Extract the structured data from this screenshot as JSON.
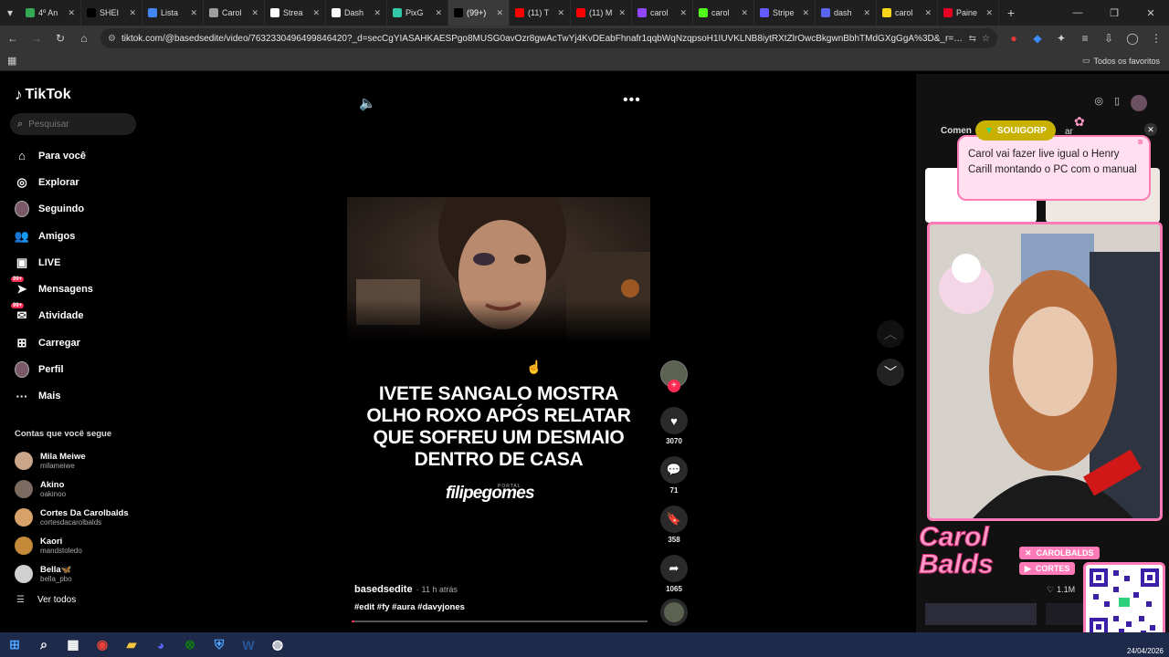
{
  "browser": {
    "tabs": [
      {
        "label": "4º An",
        "color": "#34a853"
      },
      {
        "label": "SHEI",
        "color": "#000000"
      },
      {
        "label": "Lista",
        "color": "#4285f4"
      },
      {
        "label": "Carol",
        "color": "#9e9e9e"
      },
      {
        "label": "Strea",
        "color": "#ffffff"
      },
      {
        "label": "Dash",
        "color": "#ffffff"
      },
      {
        "label": "PixG",
        "color": "#34c7a5"
      },
      {
        "label": "(99+)",
        "color": "#000000",
        "active": true
      },
      {
        "label": "(11) T",
        "color": "#ff0000"
      },
      {
        "label": "(11) M",
        "color": "#ff0000"
      },
      {
        "label": "carol",
        "color": "#9146ff"
      },
      {
        "label": "carol",
        "color": "#53fc18"
      },
      {
        "label": "Stripe",
        "color": "#635bff"
      },
      {
        "label": "dash",
        "color": "#5865f2"
      },
      {
        "label": "carol",
        "color": "#f9d71c"
      },
      {
        "label": "Paine",
        "color": "#e60023"
      }
    ],
    "new_tab": "+",
    "url": "tiktok.com/@basedsedite/video/7632330496499846420?_d=secCgYIASAHKAESPgo8MUSG0avOzr8gwAcTwYj4KvDEabFhnafr1qqbWqNzqpsoH1IUVKLNB8iytRXtZlrOwcBkgwnBbhTMdGXgGgA%3D&_r=1&_svg=1&checksum=38...",
    "bookmarks_label": "Todos os favoritos"
  },
  "tiktok": {
    "logo": "TikTok",
    "search_placeholder": "Pesquisar",
    "nav": [
      {
        "label": "Para você",
        "icon": "home-icon",
        "glyph": "⌂"
      },
      {
        "label": "Explorar",
        "icon": "compass-icon",
        "glyph": "◎"
      },
      {
        "label": "Seguindo",
        "icon": "following-avatar-icon",
        "glyph": "●"
      },
      {
        "label": "Amigos",
        "icon": "friends-icon",
        "glyph": "👥"
      },
      {
        "label": "LIVE",
        "icon": "live-icon",
        "glyph": "▣"
      },
      {
        "label": "Mensagens",
        "icon": "messages-icon",
        "glyph": "➤",
        "badge": "99+"
      },
      {
        "label": "Atividade",
        "icon": "activity-icon",
        "glyph": "✉",
        "badge": "99+"
      },
      {
        "label": "Carregar",
        "icon": "upload-icon",
        "glyph": "⊞"
      },
      {
        "label": "Perfil",
        "icon": "profile-avatar-icon",
        "glyph": "●"
      },
      {
        "label": "Mais",
        "icon": "more-icon",
        "glyph": "···"
      }
    ],
    "following_title": "Contas que você segue",
    "following": [
      {
        "name": "Mila Meiwe",
        "handle": "milameiwe",
        "color": "#c9a58a"
      },
      {
        "name": "Akino",
        "handle": "oakinoo",
        "color": "#7a6a60"
      },
      {
        "name": "Cortes Da Carolbalds",
        "handle": "cortesdacarolbalds",
        "color": "#d8a36a"
      },
      {
        "name": "Kaori",
        "handle": "mandstoledo",
        "color": "#c48a3a"
      },
      {
        "name": "Bella🦋",
        "handle": "bella_pbo",
        "color": "#d0d0d0"
      }
    ],
    "see_all": "Ver todos",
    "video": {
      "headline": "IVETE SANGALO MOSTRA OLHO ROXO APÓS RELATAR QUE SOFREU UM DESMAIO DENTRO DE CASA",
      "brand_small": "PORTAL",
      "brand": "filipegomes",
      "author": "basedsedite",
      "time_ago": "· 11 h atrás",
      "tags": "#edit #fy #aura #davyjones",
      "progress": 0.01
    },
    "actions": {
      "likes": "3070",
      "comments": "71",
      "saves": "358",
      "shares": "1065"
    }
  },
  "overlay": {
    "comments_tab": "Comen",
    "next_tab": "ar",
    "chat_user": "SOUIGORP",
    "chat_message": "Carol vai fazer live igual o Henry Carill montando o PC com o manual",
    "stream_name": "Carol Balds",
    "social_1": "CAROLBALDS",
    "social_2": "CORTES",
    "count": "1.1M"
  },
  "taskbar": {
    "date": "24/04/2026",
    "apps": [
      {
        "icon": "windows-start-icon",
        "glyph": "⊞",
        "color": "#4aa3ff"
      },
      {
        "icon": "search-icon",
        "glyph": "⌕",
        "color": "#ffffff"
      },
      {
        "icon": "task-view-icon",
        "glyph": "▦",
        "color": "#ffffff"
      },
      {
        "icon": "chrome-icon",
        "glyph": "◉",
        "color": "#ea4335"
      },
      {
        "icon": "file-explorer-icon",
        "glyph": "▰",
        "color": "#f5c542"
      },
      {
        "icon": "discord-icon",
        "glyph": "◕",
        "color": "#5865f2"
      },
      {
        "icon": "xbox-icon",
        "glyph": "⊗",
        "color": "#107c10"
      },
      {
        "icon": "defender-icon",
        "glyph": "⛨",
        "color": "#4aa3ff"
      },
      {
        "icon": "word-icon",
        "glyph": "W",
        "color": "#2b579a"
      },
      {
        "icon": "obs-icon",
        "glyph": "◍",
        "color": "#ffffff"
      }
    ]
  }
}
